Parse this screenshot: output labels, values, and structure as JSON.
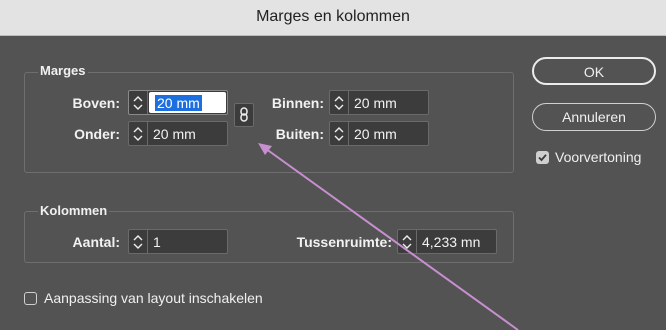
{
  "window": {
    "title": "Marges en kolommen"
  },
  "marges": {
    "group_label": "Marges",
    "boven": {
      "label": "Boven:",
      "value": "20 mm"
    },
    "onder": {
      "label": "Onder:",
      "value": "20 mm"
    },
    "binnen": {
      "label": "Binnen:",
      "value": "20 mm"
    },
    "buiten": {
      "label": "Buiten:",
      "value": "20 mm"
    },
    "link_icon": "chain-link-icon"
  },
  "kolommen": {
    "group_label": "Kolommen",
    "aantal": {
      "label": "Aantal:",
      "value": "1"
    },
    "tussenruimte": {
      "label": "Tussenruimte:",
      "value": "4,233 mn"
    }
  },
  "buttons": {
    "ok": "OK",
    "cancel": "Annuleren"
  },
  "voorvertoning": {
    "label": "Voorvertoning",
    "checked": true
  },
  "aanpassing": {
    "label": "Aanpassing van layout inschakelen",
    "checked": false
  },
  "annotation": {
    "color": "#c88fd0"
  }
}
